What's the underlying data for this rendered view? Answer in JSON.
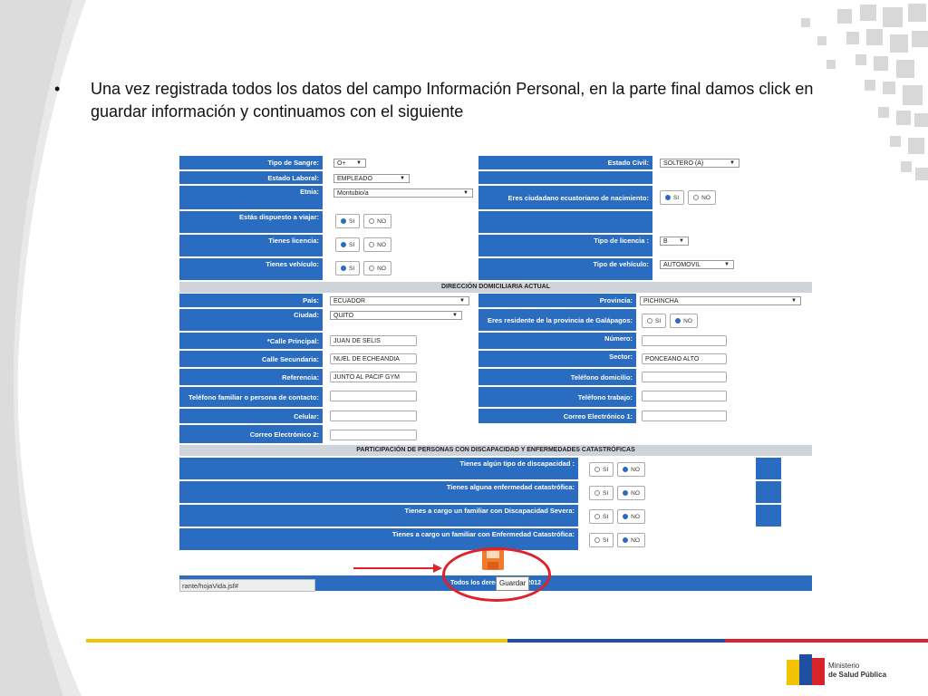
{
  "slide": {
    "bullet": "•",
    "text": "Una vez registrada todos los datos del campo Información Personal, en la parte final damos click en guardar información y continuamos con el siguiente"
  },
  "form": {
    "tipo_sangre": {
      "label": "Tipo de Sangre:",
      "value": "O+"
    },
    "estado_civil": {
      "label": "Estado Civil:",
      "value": "SOLTERO (A)"
    },
    "estado_laboral": {
      "label": "Estado Laboral:",
      "value": "EMPLEADO"
    },
    "etnia": {
      "label": "Etnia:",
      "value": "Montubio/a"
    },
    "ciudadano": {
      "label": "Eres ciudadano ecuatoriano de nacimiento:"
    },
    "viajar": {
      "label": "Estás dispuesto a viajar:"
    },
    "licencia": {
      "label": "Tienes licencia:"
    },
    "tipo_licencia": {
      "label": "Tipo de licencia :",
      "value": "B"
    },
    "vehiculo": {
      "label": "Tienes vehículo:"
    },
    "tipo_vehiculo": {
      "label": "Tipo de vehículo:",
      "value": "AUTOMOVIL"
    },
    "radio_si": "SI",
    "radio_no": "NO",
    "sect_domicilio": "DIRECCIÓN DOMICILIARIA ACTUAL",
    "pais": {
      "label": "País:",
      "value": "ECUADOR"
    },
    "provincia": {
      "label": "Provincia:",
      "value": "PICHINCHA"
    },
    "ciudad": {
      "label": "Ciudad:",
      "value": "QUITO"
    },
    "residente": {
      "label": "Eres residente de la provincia de Galápagos:"
    },
    "calle_principal": {
      "label": "*Calle Principal:",
      "value": "JUAN DE SELIS"
    },
    "numero": {
      "label": "Número:",
      "value": ""
    },
    "calle_secundaria": {
      "label": "Calle Secundaria:",
      "value": "NUEL DE ECHEANDIA"
    },
    "sector": {
      "label": "Sector:",
      "value": "PONCEANO ALTO"
    },
    "referencia": {
      "label": "Referencia:",
      "value": "JUNTO AL PACIF GYM"
    },
    "tel_domicilio": {
      "label": "Teléfono domicilio:",
      "value": ""
    },
    "tel_familiar": {
      "label": "Teléfono familiar o persona de contacto:",
      "value": ""
    },
    "tel_trabajo": {
      "label": "Teléfono trabajo:",
      "value": ""
    },
    "celular": {
      "label": "Celular:",
      "value": ""
    },
    "correo1": {
      "label": "Correo Electrónico 1:",
      "value": ""
    },
    "correo2": {
      "label": "Correo Electrónico 2:",
      "value": ""
    },
    "sect_discapacidad": "PARTICIPACIÓN DE PERSONAS CON DISCAPACIDAD Y ENFERMEDADES CATASTRÓFICAS",
    "discapacidad": {
      "label": "Tienes algún tipo de discapacidad :"
    },
    "enfermedad": {
      "label": "Tienes alguna enfermedad catastrófica:"
    },
    "familiar_disc": {
      "label": "Tienes a cargo un familiar con Discapacidad Severa:"
    },
    "familiar_enf": {
      "label": "Tienes a cargo un familiar con Enfermedad Catastrófica:"
    },
    "footer": "Todos los derechos MSP 2012",
    "url": "rante/hojaVida.jsf#",
    "tooltip": "Guardar"
  },
  "colors": {
    "form_blue": "#2a6cc0",
    "highlight_red": "#e0202a"
  },
  "brand": {
    "line1": "Ministerio",
    "line2": "de Salud Pública"
  }
}
